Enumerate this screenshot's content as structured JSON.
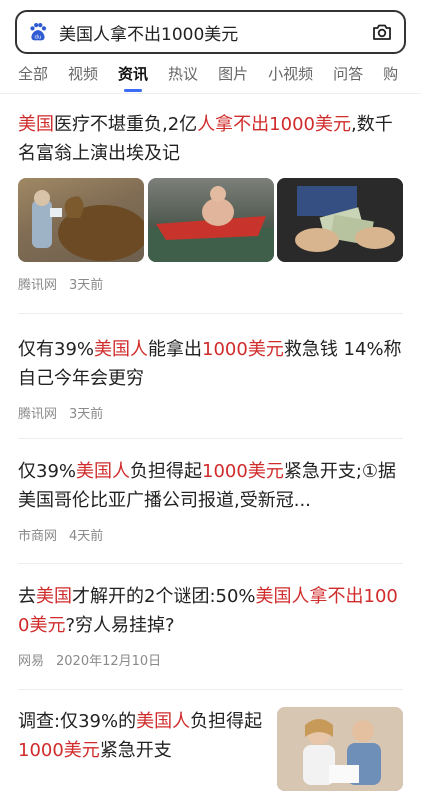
{
  "search": {
    "query": "美国人拿不出1000美元"
  },
  "tabs": [
    {
      "label": "全部",
      "active": false
    },
    {
      "label": "视频",
      "active": false
    },
    {
      "label": "资讯",
      "active": true
    },
    {
      "label": "热议",
      "active": false
    },
    {
      "label": "图片",
      "active": false
    },
    {
      "label": "小视频",
      "active": false
    },
    {
      "label": "问答",
      "active": false
    },
    {
      "label": "购",
      "active": false
    }
  ],
  "results": [
    {
      "headline_parts": [
        {
          "text": "美国",
          "hl": true
        },
        {
          "text": "医疗不堪重负,2亿",
          "hl": false
        },
        {
          "text": "人拿不出1000美元",
          "hl": true
        },
        {
          "text": ",数千名富翁上演出埃及记",
          "hl": false
        }
      ],
      "source": "腾讯网",
      "time": "3天前"
    },
    {
      "headline_parts": [
        {
          "text": "仅有39%",
          "hl": false
        },
        {
          "text": "美国人",
          "hl": true
        },
        {
          "text": "能拿出",
          "hl": false
        },
        {
          "text": "1000美元",
          "hl": true
        },
        {
          "text": "救急钱 14%称自己今年会更穷",
          "hl": false
        }
      ],
      "source": "腾讯网",
      "time": "3天前"
    },
    {
      "headline_parts": [
        {
          "text": "仅39%",
          "hl": false
        },
        {
          "text": "美国人",
          "hl": true
        },
        {
          "text": "负担得起",
          "hl": false
        },
        {
          "text": "1000美元",
          "hl": true
        },
        {
          "text": "紧急开支;①据美国哥伦比亚广播公司报道,受新冠...",
          "hl": false
        }
      ],
      "source": "市商网",
      "time": "4天前"
    },
    {
      "headline_parts": [
        {
          "text": "去",
          "hl": false
        },
        {
          "text": "美国",
          "hl": true
        },
        {
          "text": "才解开的2个谜团:50%",
          "hl": false
        },
        {
          "text": "美国人拿不出1000美元",
          "hl": true
        },
        {
          "text": "?穷人易挂掉?",
          "hl": false
        }
      ],
      "source": "网易",
      "time": "2020年12月10日"
    },
    {
      "headline_parts": [
        {
          "text": "调查:仅39%的",
          "hl": false
        },
        {
          "text": "美国人",
          "hl": true
        },
        {
          "text": "负担得起",
          "hl": false
        },
        {
          "text": "1000美元",
          "hl": true
        },
        {
          "text": "紧急开支",
          "hl": false
        }
      ]
    }
  ],
  "colors": {
    "highlight": "#d12c2c",
    "tab_indicator": "#3a6cf4",
    "meta": "#8a8a8a"
  },
  "icons": {
    "logo": "baidu-paw-icon",
    "camera": "camera-icon"
  }
}
